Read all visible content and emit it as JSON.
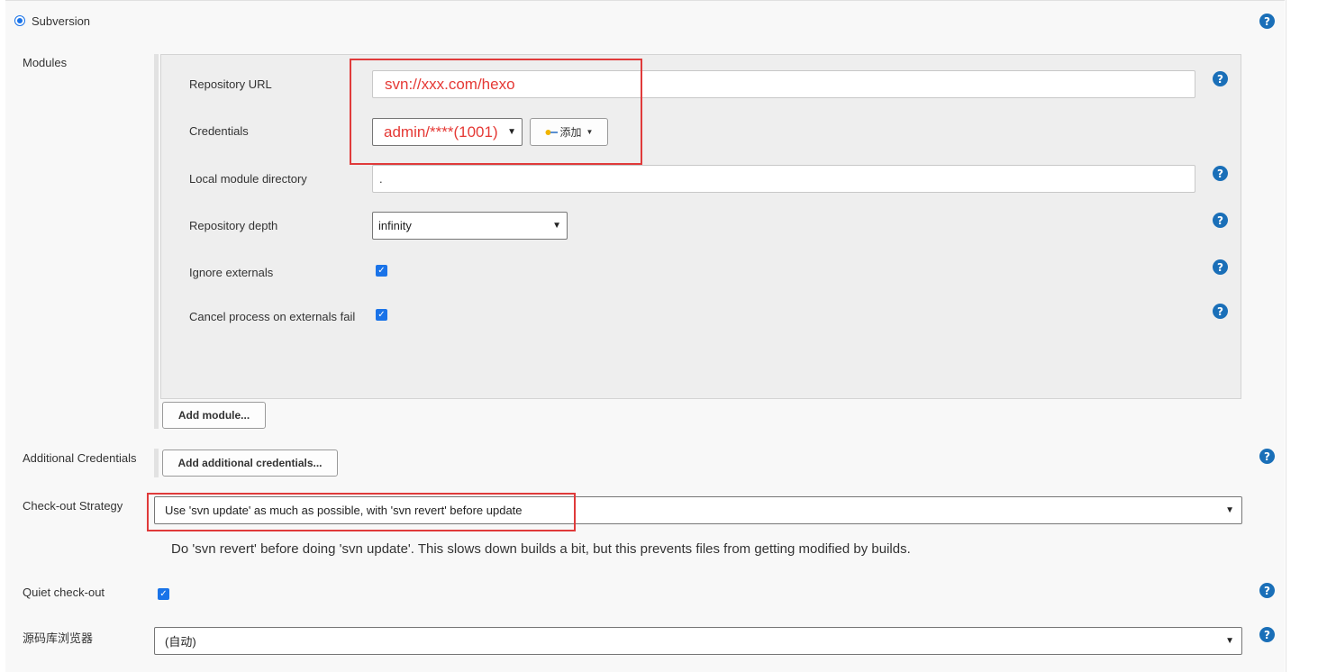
{
  "scm": {
    "label": "Subversion",
    "selected": true
  },
  "modules": {
    "label": "Modules",
    "repository_url": {
      "label": "Repository URL",
      "value": "svn://xxx.com/hexo"
    },
    "credentials": {
      "label": "Credentials",
      "value": "admin/****(1001)",
      "add_button": "添加"
    },
    "local_module_directory": {
      "label": "Local module directory",
      "value": "."
    },
    "repository_depth": {
      "label": "Repository depth",
      "value": "infinity"
    },
    "ignore_externals": {
      "label": "Ignore externals",
      "checked": true
    },
    "cancel_on_externals_fail": {
      "label": "Cancel process on externals fail",
      "checked": true
    },
    "add_module_button": "Add module..."
  },
  "additional_credentials": {
    "label": "Additional Credentials",
    "button": "Add additional credentials..."
  },
  "checkout_strategy": {
    "label": "Check-out Strategy",
    "value": "Use 'svn update' as much as possible, with 'svn revert' before update",
    "description": "Do 'svn revert' before doing 'svn update'. This slows down builds a bit, but this prevents files from getting modified by builds."
  },
  "quiet_checkout": {
    "label": "Quiet check-out",
    "checked": true
  },
  "repository_browser": {
    "label": "源码库浏览器",
    "value": "(自动)"
  },
  "help_symbol": "?",
  "colors": {
    "accent": "#1a73e8",
    "help": "#1a6fb8",
    "highlight": "#e03a3a"
  }
}
